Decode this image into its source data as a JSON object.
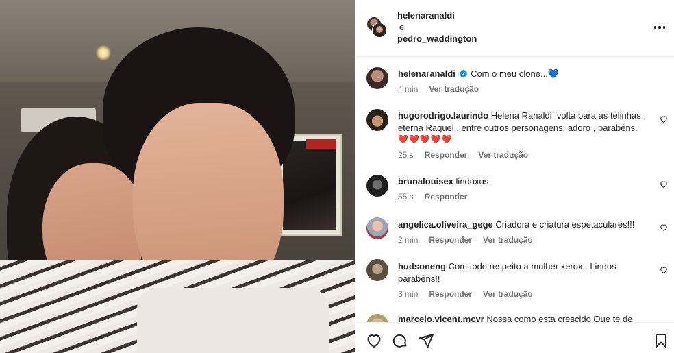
{
  "post_header": {
    "user1": "helenaranaldi",
    "conjunction": "e",
    "user2": "pedro_waddington"
  },
  "caption": {
    "username": "helenaranaldi",
    "text": "Com o meu clone...💙",
    "time": "4 min",
    "translate": "Ver tradução"
  },
  "comments": [
    {
      "username": "hugorodrigo.laurindo",
      "text": "Helena Ranaldi, volta para as telinhas, eterna Raquel , entre outros personagens, adoro , parabéns.",
      "emoji": "❤️❤️❤️❤️❤️",
      "time": "25 s",
      "reply": "Responder",
      "translate": "Ver tradução"
    },
    {
      "username": "brunalouisex",
      "text": "linduxos",
      "time": "55 s",
      "reply": "Responder"
    },
    {
      "username": "angelica.oliveira_gege",
      "text": "Criadora e criatura espetaculares!!!",
      "time": "2 min",
      "reply": "Responder",
      "translate": "Ver tradução"
    },
    {
      "username": "hudsoneng",
      "text": "Com todo respeito a mulher xerox.. Lindos parabéns!!",
      "time": "3 min",
      "reply": "Responder",
      "translate": "Ver tradução"
    },
    {
      "username": "marcelo.vicent.mcvr",
      "text": "Nossa como esta crescido Que te de"
    }
  ],
  "icons": {
    "like": "heart-icon",
    "comment": "comment-icon",
    "share": "send-icon",
    "save": "bookmark-icon",
    "more": "more-options-icon",
    "verified": "verified-badge-icon"
  },
  "colors": {
    "verified_blue": "#0095f6",
    "text": "#262626",
    "muted": "#737373",
    "heart_red": "#e0245e"
  }
}
